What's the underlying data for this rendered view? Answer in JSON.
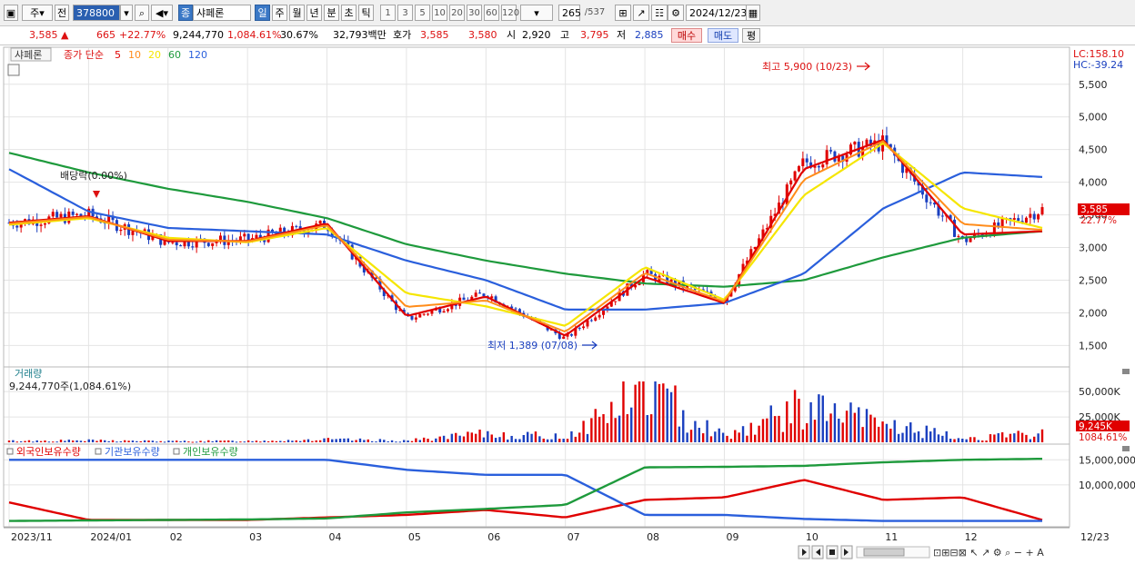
{
  "toolbar": {
    "market_kind": "주",
    "market_scope": "전",
    "stock_code": "378800",
    "stock_name": "샤페론",
    "name_badge": "종",
    "periods": [
      "일",
      "주",
      "월",
      "년",
      "분",
      "초",
      "틱"
    ],
    "active_period": "일",
    "intervals": [
      "1",
      "3",
      "5",
      "10",
      "20",
      "30",
      "60",
      "120"
    ],
    "count_value": "265",
    "count_total": "/537",
    "date": "2024/12/23"
  },
  "infobar": {
    "price": "3,585",
    "change_arrow": "▲",
    "change": "665",
    "change_pct": "+22.77%",
    "volume": "9,244,770",
    "volume_ratio": "1,084.61%",
    "turnover": "30.67%",
    "amount": "32,793백만",
    "quote_label": "호가",
    "ask": "3,585",
    "bid": "3,580",
    "open_label": "시",
    "open": "2,920",
    "high_label": "고",
    "high": "3,795",
    "low_label": "저",
    "low": "2,885",
    "buy_label": "매수",
    "sell_label": "매도",
    "eval_label": "평"
  },
  "price_panel": {
    "stock_tab": "샤페론",
    "ma_label": "종가 단순",
    "ma_periods": [
      {
        "label": "5",
        "color": "#e00000"
      },
      {
        "label": "10",
        "color": "#ff8c1a"
      },
      {
        "label": "20",
        "color": "#f5e600"
      },
      {
        "label": "60",
        "color": "#1e9a3c"
      },
      {
        "label": "120",
        "color": "#2a5fdc"
      }
    ],
    "lc_label": "LC:158.10",
    "hc_label": "HC:-39.24",
    "dividend_label": "배당락(0.00%)",
    "high_annotation": "최고 5,900 (10/23)",
    "low_annotation": "최저 1,389 (07/08)",
    "current_price_tag": "3,585",
    "current_pct_tag": "22.77%"
  },
  "volume_panel": {
    "title": "거래량",
    "summary": "9,244,770주(1,084.61%)",
    "current_tag": "9,245K",
    "current_pct_tag": "1084.61%"
  },
  "holding_panel": {
    "legend": [
      {
        "label": "외국인보유수량",
        "color": "#e00000"
      },
      {
        "label": "기관보유수량",
        "color": "#2a5fdc"
      },
      {
        "label": "개인보유수량",
        "color": "#1e9a3c"
      }
    ]
  },
  "xaxis": {
    "labels": [
      "2023/11",
      "2024/01",
      "02",
      "03",
      "04",
      "05",
      "06",
      "07",
      "08",
      "09",
      "10",
      "11",
      "12"
    ],
    "right_label": "12/23"
  },
  "colors": {
    "up": "#e00000",
    "down": "#1a3fbf",
    "grid": "#e4e4e4"
  },
  "chart_data": [
    {
      "type": "candlestick",
      "name": "price",
      "ylim": [
        1200,
        5900
      ],
      "y_ticks": [
        "1,500",
        "2,000",
        "2,500",
        "3,000",
        "3,500",
        "4,000",
        "4,500",
        "5,000",
        "5,500"
      ],
      "x": [
        "2023/11",
        "2024/01",
        "02",
        "03",
        "04",
        "05",
        "06",
        "07",
        "08",
        "09",
        "10",
        "11",
        "12",
        "12/23"
      ],
      "close": [
        3380,
        3500,
        3080,
        3120,
        3350,
        1900,
        2300,
        1600,
        2600,
        2200,
        4300,
        4600,
        3100,
        3585
      ],
      "ma5": [
        3380,
        3480,
        3100,
        3100,
        3370,
        1950,
        2250,
        1650,
        2550,
        2150,
        4200,
        4650,
        3200,
        3250
      ],
      "ma20": [
        3350,
        3450,
        3150,
        3080,
        3300,
        2300,
        2100,
        1800,
        2700,
        2200,
        3800,
        4600,
        3600,
        3300
      ],
      "ma60": [
        4200,
        3550,
        3300,
        3250,
        3200,
        2800,
        2500,
        2050,
        2050,
        2150,
        2600,
        3600,
        4150,
        4080
      ],
      "ma120": [
        4450,
        4150,
        3900,
        3700,
        3450,
        3050,
        2800,
        2600,
        2450,
        2400,
        2500,
        2850,
        3150,
        3250
      ]
    },
    {
      "type": "bar",
      "name": "volume",
      "ylim": [
        0,
        60000
      ],
      "y_ticks": [
        "25,000K",
        "50,000K"
      ],
      "x": [
        "2023/11",
        "2024/01",
        "02",
        "03",
        "04",
        "05",
        "06",
        "07",
        "08",
        "09",
        "10",
        "11",
        "12",
        "12/23"
      ],
      "values": [
        1500,
        2000,
        1200,
        1500,
        3000,
        1800,
        9000,
        6000,
        58000,
        7000,
        38000,
        20000,
        4000,
        9245
      ]
    },
    {
      "type": "line",
      "name": "holdings",
      "ylim": [
        2000000,
        16500000
      ],
      "y_ticks": [
        "10,000,000",
        "15,000,000"
      ],
      "x": [
        "2023/11",
        "2024/01",
        "02",
        "03",
        "04",
        "05",
        "06",
        "07",
        "08",
        "09",
        "10",
        "11",
        "12",
        "12/23"
      ],
      "series": [
        {
          "name": "외국인보유수량",
          "values": [
            6500000,
            3000000,
            3000000,
            3000000,
            3500000,
            4000000,
            5000000,
            3500000,
            7000000,
            7500000,
            11000000,
            7000000,
            7500000,
            3000000
          ]
        },
        {
          "name": "기관보유수량",
          "values": [
            15000000,
            15000000,
            15000000,
            15000000,
            15000000,
            13000000,
            12000000,
            12000000,
            4000000,
            4000000,
            3200000,
            2800000,
            2800000,
            2800000
          ]
        },
        {
          "name": "개인보유수량",
          "values": [
            2800000,
            2900000,
            3000000,
            3100000,
            3300000,
            4500000,
            5200000,
            6000000,
            13500000,
            13600000,
            13800000,
            14500000,
            15000000,
            15200000
          ]
        }
      ]
    }
  ]
}
